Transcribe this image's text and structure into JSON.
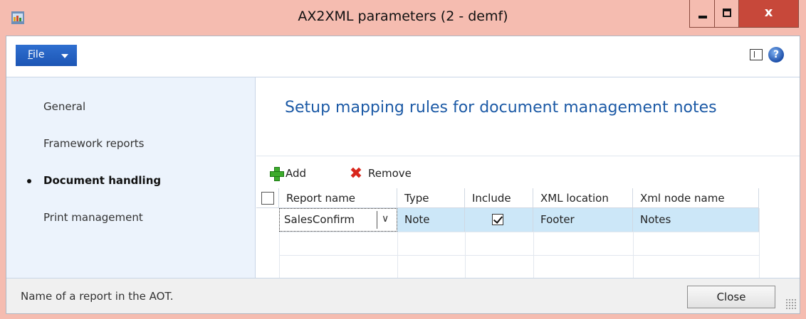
{
  "window": {
    "title": "AX2XML parameters (2 - demf)",
    "close_glyph": "x"
  },
  "menu": {
    "file_label": "File",
    "file_accel": "F",
    "file_rest": "ile",
    "help_glyph": "?"
  },
  "sidebar": {
    "items": [
      {
        "label": "General",
        "active": false
      },
      {
        "label": "Framework reports",
        "active": false
      },
      {
        "label": "Document handling",
        "active": true
      },
      {
        "label": "Print management",
        "active": false
      }
    ]
  },
  "main": {
    "title": "Setup mapping rules for document management notes",
    "toolbar": {
      "add_label": "Add",
      "remove_label": "Remove"
    },
    "grid": {
      "columns": [
        "Report name",
        "Type",
        "Include",
        "XML location",
        "Xml node name"
      ],
      "rows": [
        {
          "report_name": "SalesConfirm",
          "type": "Note",
          "include": true,
          "xml_location": "Footer",
          "xml_node_name": "Notes"
        }
      ]
    }
  },
  "statusbar": {
    "text": "Name of a report in the AOT.",
    "close_label": "Close"
  },
  "colors": {
    "accent": "#1c5aa6",
    "file_button": "#2f6fd0",
    "selected_row": "#cce7f8",
    "sidebar_bg": "#ecf3fc",
    "window_frame": "#f5bcb0",
    "close_red": "#c7483a"
  }
}
